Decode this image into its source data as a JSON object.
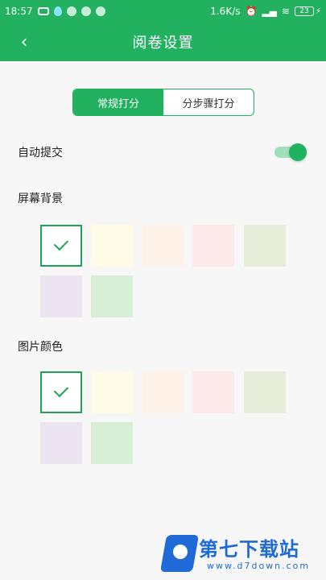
{
  "status_bar": {
    "time": "18:57",
    "network_speed": "1.6K/s",
    "battery_level": "23"
  },
  "header": {
    "back_icon": "chevron-left-icon",
    "title": "阅卷设置"
  },
  "segmented_control": {
    "options": [
      "常规打分",
      "分步骤打分"
    ],
    "selected_index": 0
  },
  "settings": {
    "auto_submit_label": "自动提交",
    "auto_submit_enabled": true,
    "screen_background_label": "屏幕背景",
    "image_color_label": "图片颜色"
  },
  "swatch_colors": [
    "#ffffff",
    "#fffbe6",
    "#fff2e8",
    "#fde9e9",
    "#e6edd8",
    "#ece4f1",
    "#d6efd6"
  ],
  "screen_background_selected_index": 0,
  "image_color_selected_index": 0,
  "brand": {
    "name": "第七下载站",
    "site": "www.d7down.com"
  },
  "colors": {
    "accent": "#22b15f"
  }
}
